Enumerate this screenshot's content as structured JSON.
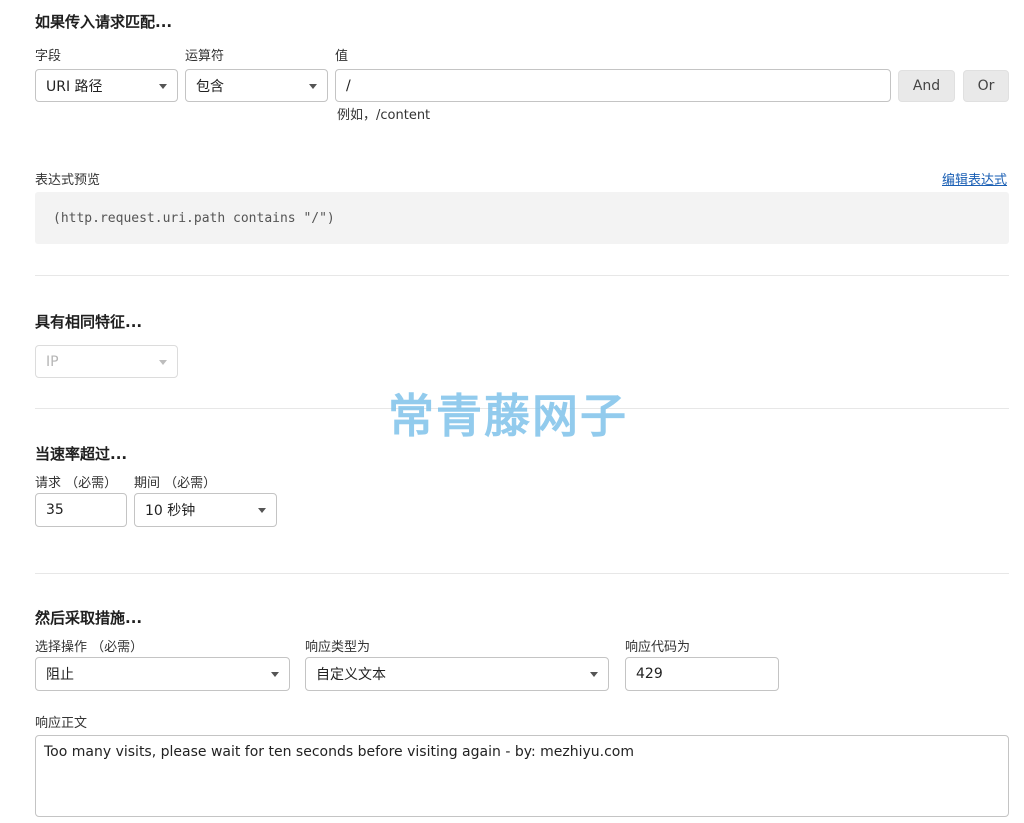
{
  "section_match": {
    "heading": "如果传入请求匹配...",
    "field_label": "字段",
    "operator_label": "运算符",
    "value_label": "值",
    "field_value": "URI 路径",
    "operator_value": "包含",
    "value_input": "/",
    "value_hint": "例如，/content",
    "and_button": "And",
    "or_button": "Or"
  },
  "expression": {
    "label": "表达式预览",
    "edit_link": "编辑表达式",
    "preview_text": "(http.request.uri.path contains \"/\")"
  },
  "section_characteristics": {
    "heading": "具有相同特征...",
    "select_value": "IP"
  },
  "watermark": "常青藤网子",
  "section_rate": {
    "heading": "当速率超过...",
    "requests_label": "请求 （必需）",
    "period_label": "期间 （必需）",
    "requests_value": "35",
    "period_value": "10 秒钟"
  },
  "section_action": {
    "heading": "然后采取措施...",
    "action_label": "选择操作 （必需）",
    "response_type_label": "响应类型为",
    "response_code_label": "响应代码为",
    "action_value": "阻止",
    "response_type_value": "自定义文本",
    "response_code_value": "429",
    "body_label": "响应正文",
    "body_value": "Too many visits, please wait for ten seconds before visiting again - by: mezhiyu.com"
  }
}
